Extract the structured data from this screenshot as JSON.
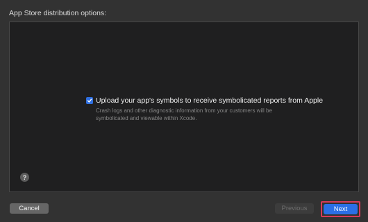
{
  "heading": "App Store distribution options:",
  "option": {
    "checked": true,
    "label": "Upload your app's symbols to receive symbolicated reports from Apple",
    "description": "Crash logs and other diagnostic information from your customers will be symbolicated and viewable within Xcode."
  },
  "help": {
    "label": "?"
  },
  "buttons": {
    "cancel": "Cancel",
    "previous": "Previous",
    "next": "Next"
  },
  "colors": {
    "accent": "#2b6fe6",
    "highlight": "#d93a58"
  }
}
